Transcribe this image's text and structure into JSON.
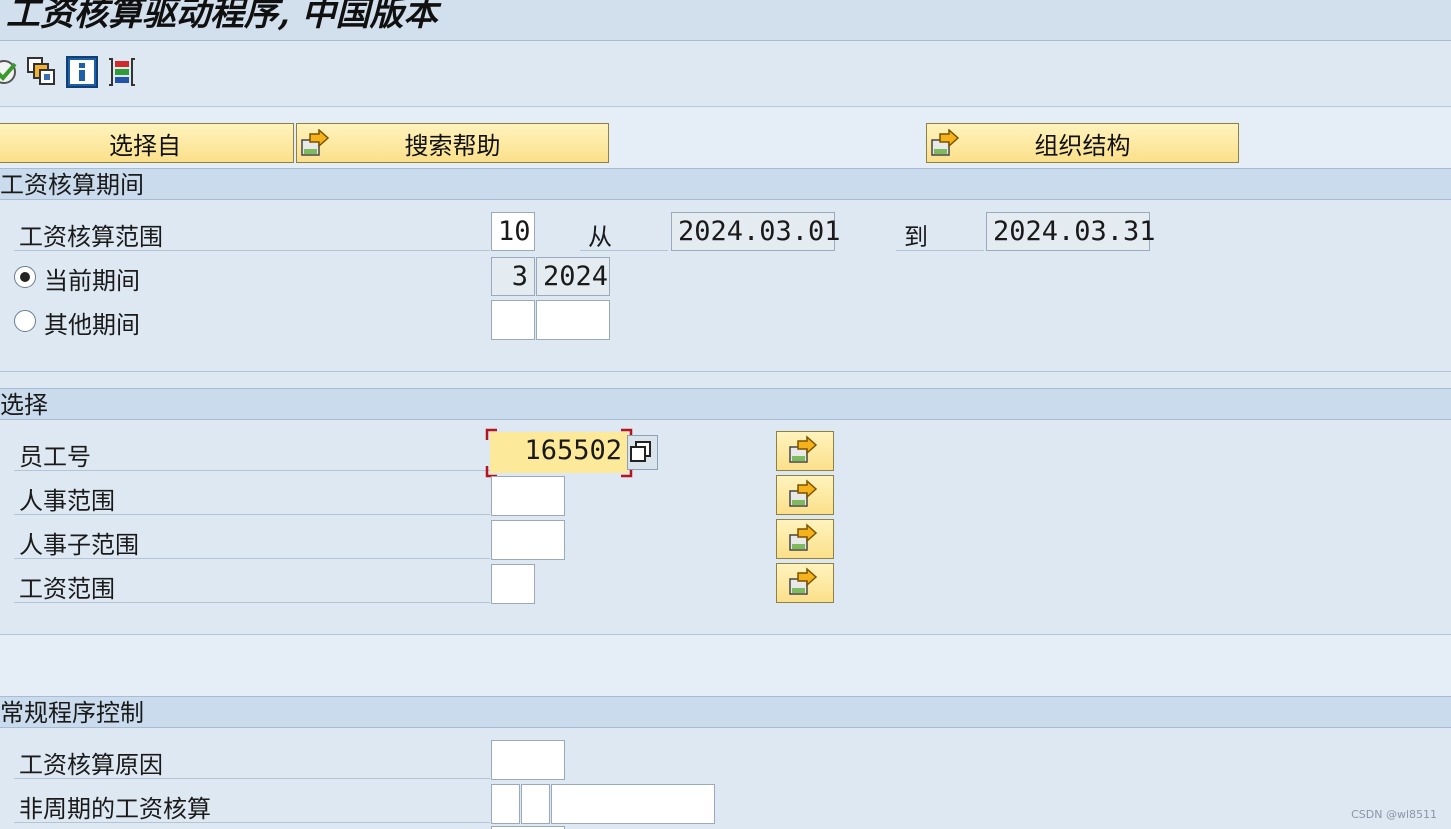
{
  "window": {
    "title": "工资核算驱动程序, 中国版本"
  },
  "toolbar": {
    "icons": [
      "execute-icon",
      "variants-icon",
      "info-icon",
      "selection-options-icon"
    ]
  },
  "buttons": {
    "select_from": "选择自",
    "search_help": "搜索帮助",
    "org_structure": "组织结构"
  },
  "period_section": {
    "title": "工资核算期间",
    "payroll_area_label": "工资核算范围",
    "payroll_area_value": "10",
    "from_label": "从",
    "from_value": "2024.03.01",
    "to_label": "到",
    "to_value": "2024.03.31",
    "current_period_label": "当前期间",
    "current_period_month": "3",
    "current_period_year": "2024",
    "other_period_label": "其他期间",
    "selected_option": "当前期间"
  },
  "selection_section": {
    "title": "选择",
    "employee_no_label": "员工号",
    "employee_no_value": "165502",
    "personnel_area_label": "人事范围",
    "personnel_subarea_label": "人事子范围",
    "payroll_area_label": "工资范围"
  },
  "general_section": {
    "title": "常规程序控制",
    "reason_label": "工资核算原因",
    "offcycle_label": "非周期的工资核算"
  },
  "watermark": "CSDN @wl8511"
}
